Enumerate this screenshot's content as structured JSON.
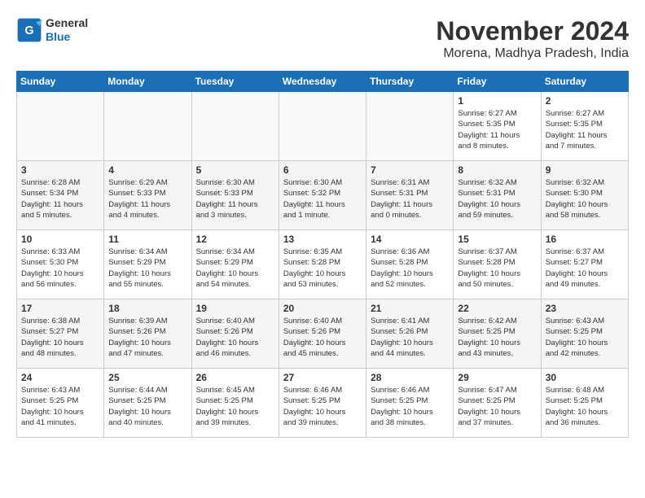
{
  "logo": {
    "general": "General",
    "blue": "Blue"
  },
  "title": "November 2024",
  "subtitle": "Morena, Madhya Pradesh, India",
  "weekdays": [
    "Sunday",
    "Monday",
    "Tuesday",
    "Wednesday",
    "Thursday",
    "Friday",
    "Saturday"
  ],
  "weeks": [
    [
      {
        "day": "",
        "info": ""
      },
      {
        "day": "",
        "info": ""
      },
      {
        "day": "",
        "info": ""
      },
      {
        "day": "",
        "info": ""
      },
      {
        "day": "",
        "info": ""
      },
      {
        "day": "1",
        "info": "Sunrise: 6:27 AM\nSunset: 5:35 PM\nDaylight: 11 hours\nand 8 minutes."
      },
      {
        "day": "2",
        "info": "Sunrise: 6:27 AM\nSunset: 5:35 PM\nDaylight: 11 hours\nand 7 minutes."
      }
    ],
    [
      {
        "day": "3",
        "info": "Sunrise: 6:28 AM\nSunset: 5:34 PM\nDaylight: 11 hours\nand 5 minutes."
      },
      {
        "day": "4",
        "info": "Sunrise: 6:29 AM\nSunset: 5:33 PM\nDaylight: 11 hours\nand 4 minutes."
      },
      {
        "day": "5",
        "info": "Sunrise: 6:30 AM\nSunset: 5:33 PM\nDaylight: 11 hours\nand 3 minutes."
      },
      {
        "day": "6",
        "info": "Sunrise: 6:30 AM\nSunset: 5:32 PM\nDaylight: 11 hours\nand 1 minute."
      },
      {
        "day": "7",
        "info": "Sunrise: 6:31 AM\nSunset: 5:31 PM\nDaylight: 11 hours\nand 0 minutes."
      },
      {
        "day": "8",
        "info": "Sunrise: 6:32 AM\nSunset: 5:31 PM\nDaylight: 10 hours\nand 59 minutes."
      },
      {
        "day": "9",
        "info": "Sunrise: 6:32 AM\nSunset: 5:30 PM\nDaylight: 10 hours\nand 58 minutes."
      }
    ],
    [
      {
        "day": "10",
        "info": "Sunrise: 6:33 AM\nSunset: 5:30 PM\nDaylight: 10 hours\nand 56 minutes."
      },
      {
        "day": "11",
        "info": "Sunrise: 6:34 AM\nSunset: 5:29 PM\nDaylight: 10 hours\nand 55 minutes."
      },
      {
        "day": "12",
        "info": "Sunrise: 6:34 AM\nSunset: 5:29 PM\nDaylight: 10 hours\nand 54 minutes."
      },
      {
        "day": "13",
        "info": "Sunrise: 6:35 AM\nSunset: 5:28 PM\nDaylight: 10 hours\nand 53 minutes."
      },
      {
        "day": "14",
        "info": "Sunrise: 6:36 AM\nSunset: 5:28 PM\nDaylight: 10 hours\nand 52 minutes."
      },
      {
        "day": "15",
        "info": "Sunrise: 6:37 AM\nSunset: 5:28 PM\nDaylight: 10 hours\nand 50 minutes."
      },
      {
        "day": "16",
        "info": "Sunrise: 6:37 AM\nSunset: 5:27 PM\nDaylight: 10 hours\nand 49 minutes."
      }
    ],
    [
      {
        "day": "17",
        "info": "Sunrise: 6:38 AM\nSunset: 5:27 PM\nDaylight: 10 hours\nand 48 minutes."
      },
      {
        "day": "18",
        "info": "Sunrise: 6:39 AM\nSunset: 5:26 PM\nDaylight: 10 hours\nand 47 minutes."
      },
      {
        "day": "19",
        "info": "Sunrise: 6:40 AM\nSunset: 5:26 PM\nDaylight: 10 hours\nand 46 minutes."
      },
      {
        "day": "20",
        "info": "Sunrise: 6:40 AM\nSunset: 5:26 PM\nDaylight: 10 hours\nand 45 minutes."
      },
      {
        "day": "21",
        "info": "Sunrise: 6:41 AM\nSunset: 5:26 PM\nDaylight: 10 hours\nand 44 minutes."
      },
      {
        "day": "22",
        "info": "Sunrise: 6:42 AM\nSunset: 5:25 PM\nDaylight: 10 hours\nand 43 minutes."
      },
      {
        "day": "23",
        "info": "Sunrise: 6:43 AM\nSunset: 5:25 PM\nDaylight: 10 hours\nand 42 minutes."
      }
    ],
    [
      {
        "day": "24",
        "info": "Sunrise: 6:43 AM\nSunset: 5:25 PM\nDaylight: 10 hours\nand 41 minutes."
      },
      {
        "day": "25",
        "info": "Sunrise: 6:44 AM\nSunset: 5:25 PM\nDaylight: 10 hours\nand 40 minutes."
      },
      {
        "day": "26",
        "info": "Sunrise: 6:45 AM\nSunset: 5:25 PM\nDaylight: 10 hours\nand 39 minutes."
      },
      {
        "day": "27",
        "info": "Sunrise: 6:46 AM\nSunset: 5:25 PM\nDaylight: 10 hours\nand 39 minutes."
      },
      {
        "day": "28",
        "info": "Sunrise: 6:46 AM\nSunset: 5:25 PM\nDaylight: 10 hours\nand 38 minutes."
      },
      {
        "day": "29",
        "info": "Sunrise: 6:47 AM\nSunset: 5:25 PM\nDaylight: 10 hours\nand 37 minutes."
      },
      {
        "day": "30",
        "info": "Sunrise: 6:48 AM\nSunset: 5:25 PM\nDaylight: 10 hours\nand 36 minutes."
      }
    ]
  ]
}
